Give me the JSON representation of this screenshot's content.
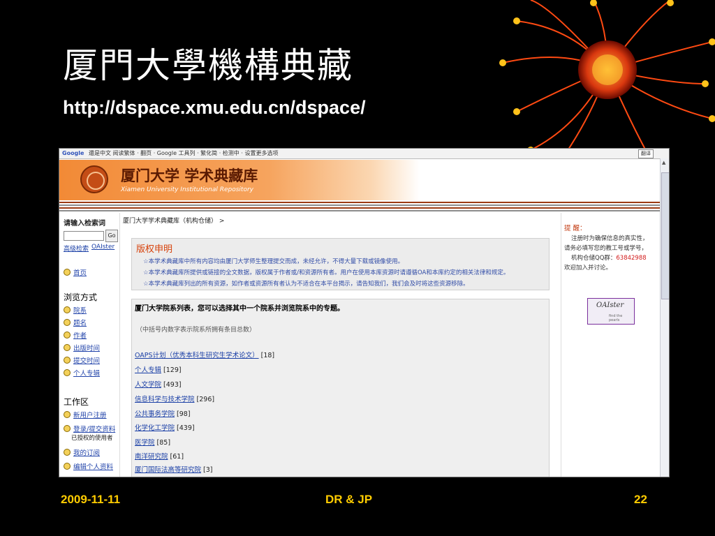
{
  "slide": {
    "title": "厦門大學機構典藏",
    "url": "http://dspace.xmu.edu.cn/dspace/",
    "footer_date": "2009-11-11",
    "footer_authors": "DR & JP",
    "footer_page": "22"
  },
  "browser": {
    "toolbar_brand": "Google",
    "toolbar_text": "還是中文 阅读繁体 · 翻页 · Google 工具列 · 繁化简 · 检测中 · 设置更多选项",
    "toolbar_button": "翻译"
  },
  "site": {
    "banner_cn": "厦门大学 学术典藏库",
    "banner_en": "Xiamen University Institutional Repository"
  },
  "leftnav": {
    "search_heading": "请输入检索词",
    "go_label": "Go",
    "advanced_search": "高级检索",
    "oaister_link": "OAIster",
    "home": "首页",
    "browse_heading": "浏览方式",
    "browse_items": [
      "院系",
      "题名",
      "作者",
      "出版时间",
      "提交时间",
      "个人专辑"
    ],
    "work_heading": "工作区",
    "work_items": [
      "新用户注册",
      "登录/提交资料",
      "我的订阅",
      "编辑个人资料"
    ],
    "authorized_note": "已授权的使用者"
  },
  "main": {
    "breadcrumb": "厦门大学学术典藏库（机构仓储） >",
    "copyright_title": "版权申明",
    "copyright_lines": [
      "☆本学术典藏库中所有内容均由厦门大学师生整理提交而成，未经允许，不得大量下载或镜像使用。",
      "☆本学术典藏库所提供或链接的全文数据，版权属于作者或/和资源所有者。用户在使用本库资源时请遵循OA和本库约定的相关法律和规定。",
      "☆本学术典藏库列出的所有资源，如作者或资源所有者认为不适合在本平台揭示，请告知我们，我们会及时将这些资源移除。"
    ],
    "list_heading": "厦门大学院系列表，您可以选择其中一个院系并浏览院系中的专题。",
    "list_subheading": "（中括号内数字表示院系所拥有条目总数）",
    "communities": [
      {
        "name": "OAPS计划（优秀本科生研究生学术论文）",
        "count": "[18]"
      },
      {
        "name": "个人专辑",
        "count": "[129]"
      },
      {
        "name": "人文学院",
        "count": "[493]"
      },
      {
        "name": "信息科学与技术学院",
        "count": "[296]"
      },
      {
        "name": "公共事务学院",
        "count": "[98]"
      },
      {
        "name": "化学化工学院",
        "count": "[439]"
      },
      {
        "name": "医学院",
        "count": "[85]"
      },
      {
        "name": "南洋研究院",
        "count": "[61]"
      },
      {
        "name": "厦门国际法高等研究院",
        "count": "[3]"
      }
    ]
  },
  "right": {
    "hint_title": "提 醒：",
    "hint_lines": [
      "注册时为确保信息的真实性，",
      "请务必填写您的教工号或学号，"
    ],
    "qq_label": "机构仓储QQ群：",
    "qq_number": "63842988",
    "welcome": "欢迎加入并讨论。",
    "logo_text": "OAIster",
    "logo_sub": "find the pearls"
  },
  "colors": {
    "slide_bg": "#000000",
    "footer_text": "#ffcc00",
    "banner_orange": "#f28a36",
    "copyright_red": "#d7420b",
    "link_blue": "#1a3fa6"
  }
}
